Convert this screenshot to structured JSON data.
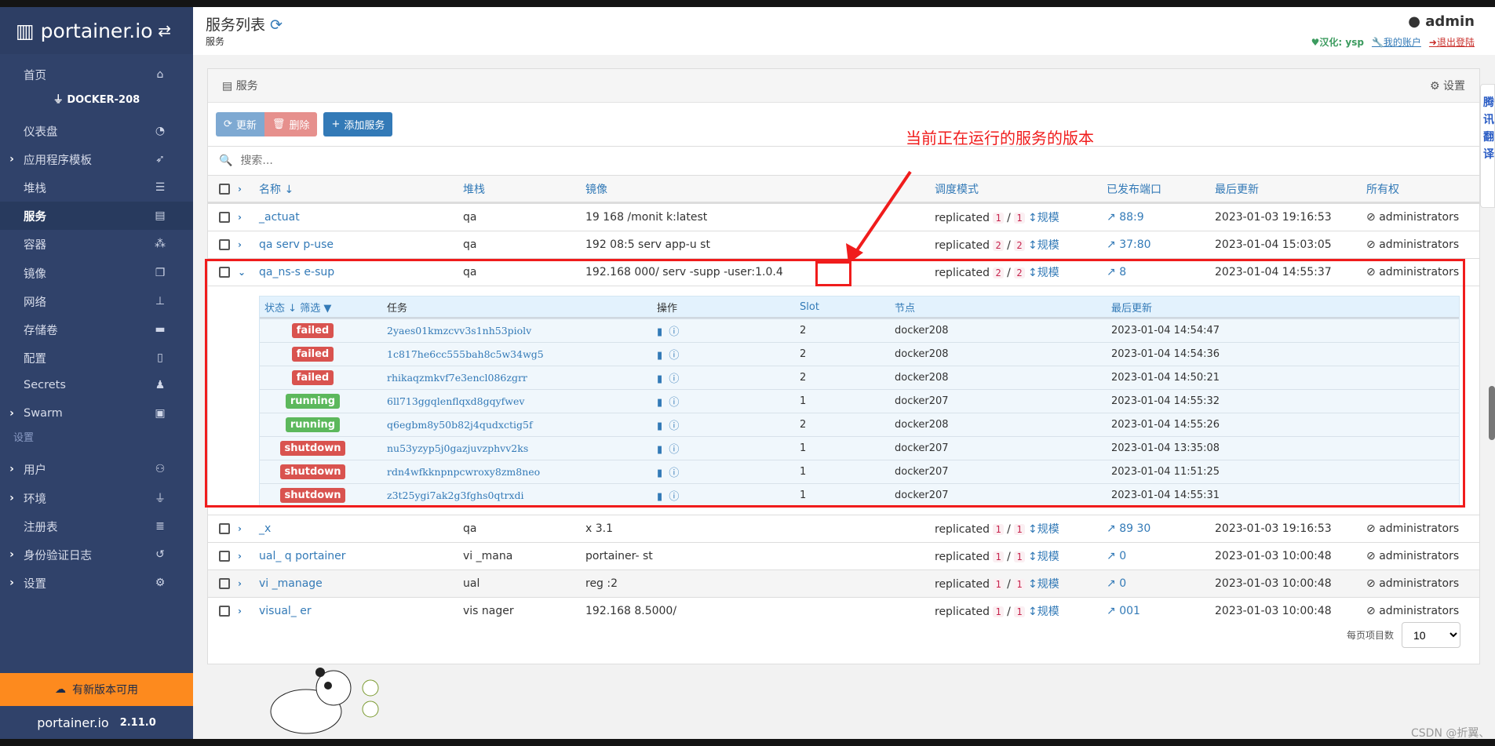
{
  "sidebar": {
    "brand": "portainer.io",
    "endpoint": "DOCKER-208",
    "section_settings": "设置",
    "items": [
      {
        "label": "首页",
        "icon": "home-icon"
      },
      {
        "label": "仪表盘",
        "icon": "dashboard-icon"
      },
      {
        "label": "应用程序模板",
        "icon": "rocket-icon",
        "expandable": true
      },
      {
        "label": "堆栈",
        "icon": "th-list-icon"
      },
      {
        "label": "服务",
        "icon": "list-alt-icon",
        "active": true
      },
      {
        "label": "容器",
        "icon": "cubes-icon"
      },
      {
        "label": "镜像",
        "icon": "clone-icon"
      },
      {
        "label": "网络",
        "icon": "sitemap-icon"
      },
      {
        "label": "存储卷",
        "icon": "hdd-icon"
      },
      {
        "label": "配置",
        "icon": "file-code-icon"
      },
      {
        "label": "Secrets",
        "icon": "user-secret-icon"
      },
      {
        "label": "Swarm",
        "icon": "object-group-icon",
        "expandable": true
      },
      {
        "label": "用户",
        "icon": "users-icon",
        "expandable": true
      },
      {
        "label": "环境",
        "icon": "plug-icon",
        "expandable": true
      },
      {
        "label": "注册表",
        "icon": "database-icon"
      },
      {
        "label": "身份验证日志",
        "icon": "history-icon",
        "expandable": true
      },
      {
        "label": "设置",
        "icon": "cogs-icon",
        "expandable": true
      }
    ],
    "update_banner": "有新版本可用",
    "version": "2.11.0"
  },
  "header": {
    "title": "服务列表",
    "subtitle": "服务",
    "user": "admin",
    "hanhua": "汉化: ysp",
    "my_account": "我的账户",
    "logout": "退出登陆"
  },
  "panel": {
    "title": "服务",
    "settings": "设置",
    "buttons": {
      "update": "更新",
      "delete": "删除",
      "add": "添加服务"
    },
    "search_placeholder": "搜索...",
    "columns": [
      "名称",
      "堆栈",
      "镜像",
      "调度模式",
      "已发布端口",
      "最后更新",
      "所有权"
    ],
    "rows": [
      {
        "name": "_actuat",
        "stack": "qa",
        "image": "19  168    /monit    k:latest",
        "mode": "replicated",
        "running": "1",
        "desired": "1",
        "scale": "规模",
        "port": "88:9",
        "updated": "2023-01-03 19:16:53",
        "owner": "administrators"
      },
      {
        "name": "qa   serv   p-use",
        "stack": "qa",
        "image": "192    08:5   serv   app-u   st",
        "mode": "replicated",
        "running": "2",
        "desired": "2",
        "scale": "规模",
        "port": "37:80",
        "updated": "2023-01-04 15:03:05",
        "owner": "administrators"
      },
      {
        "name": "qa_ns-s   e-sup",
        "stack": "qa",
        "image": "192.168    000/   serv   -supp   -user",
        "image_tag": ":1.0.4",
        "mode": "replicated",
        "running": "2",
        "desired": "2",
        "scale": "规模",
        "port": "8",
        "updated": "2023-01-04 14:55:37",
        "owner": "administrators",
        "expanded": true
      },
      {
        "name": "_x",
        "stack": "qa",
        "image": "x    3.1",
        "mode": "replicated",
        "running": "1",
        "desired": "1",
        "scale": "规模",
        "port": "89   30",
        "updated": "2023-01-03 19:16:53",
        "owner": "administrators"
      },
      {
        "name": "ual_   q   portainer",
        "stack": "vi   _mana",
        "image": "   portainer-   st",
        "mode": "replicated",
        "running": "1",
        "desired": "1",
        "scale": "规模",
        "port": "0",
        "updated": "2023-01-03 10:00:48",
        "owner": "administrators"
      },
      {
        "name": "vi   _manage",
        "stack": "ual",
        "image": "reg   :2",
        "mode": "replicated",
        "running": "1",
        "desired": "1",
        "scale": "规模",
        "port": "0",
        "updated": "2023-01-03 10:00:48",
        "owner": "administrators"
      },
      {
        "name": "visual_   er",
        "stack": "vis   nager",
        "image": "192.168   8.5000/",
        "mode": "replicated",
        "running": "1",
        "desired": "1",
        "scale": "规模",
        "port": "001",
        "updated": "2023-01-03 10:00:48",
        "owner": "administrators"
      }
    ],
    "tasks": {
      "columns": {
        "status": "状态",
        "filter": "筛选",
        "task": "任务",
        "actions": "操作",
        "slot": "Slot",
        "node": "节点",
        "updated": "最后更新"
      },
      "rows": [
        {
          "status": "failed",
          "id": "2yaes01kmzcvv3s1nh53piolv",
          "slot": "2",
          "node": "docker208",
          "updated": "2023-01-04 14:54:47"
        },
        {
          "status": "failed",
          "id": "1c817he6cc555bah8c5w34wg5",
          "slot": "2",
          "node": "docker208",
          "updated": "2023-01-04 14:54:36"
        },
        {
          "status": "failed",
          "id": "rhikaqzmkvf7e3encl086zgrr",
          "slot": "2",
          "node": "docker208",
          "updated": "2023-01-04 14:50:21"
        },
        {
          "status": "running",
          "id": "6ll713ggqlenflqxd8gqyfwev",
          "slot": "1",
          "node": "docker207",
          "updated": "2023-01-04 14:55:32"
        },
        {
          "status": "running",
          "id": "q6egbm8y50b82j4qudxctig5f",
          "slot": "2",
          "node": "docker208",
          "updated": "2023-01-04 14:55:26"
        },
        {
          "status": "shutdown",
          "id": "nu53yzyp5j0gazjuvzphvv2ks",
          "slot": "1",
          "node": "docker207",
          "updated": "2023-01-04 13:35:08"
        },
        {
          "status": "shutdown",
          "id": "rdn4wfkknpnpcwroxy8zm8neo",
          "slot": "1",
          "node": "docker207",
          "updated": "2023-01-04 11:51:25"
        },
        {
          "status": "shutdown",
          "id": "z3t25ygi7ak2g3fghs0qtrxdi",
          "slot": "1",
          "node": "docker207",
          "updated": "2023-01-04 14:55:31"
        }
      ]
    },
    "pagination": {
      "label": "每页项目数",
      "value": "10"
    }
  },
  "annotation": "当前正在运行的服务的版本",
  "side_widget": "腾讯翻译",
  "watermark": "CSDN @折翼、",
  "colors": {
    "sidebar": "#30426a",
    "accent": "#337ab7",
    "failed": "#d9534f",
    "running": "#5cb85c",
    "banner": "#fd8a1e",
    "annotation": "#f01c1c"
  }
}
